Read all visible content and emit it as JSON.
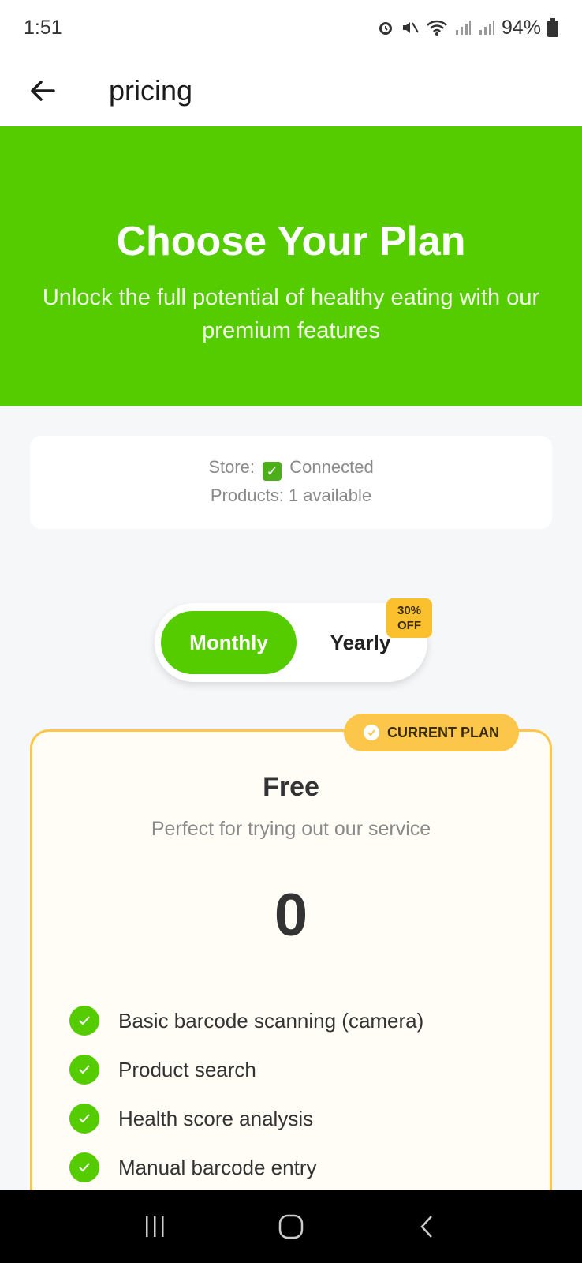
{
  "status_bar": {
    "time": "1:51",
    "battery": "94%",
    "icons": [
      "alarm-icon",
      "mute-icon",
      "wifi-icon",
      "signal-icon",
      "signal-icon",
      "battery-icon"
    ]
  },
  "app_bar": {
    "title": "pricing",
    "back_icon": "arrow-left-icon"
  },
  "hero": {
    "title": "Choose Your Plan",
    "subtitle": "Unlock the full potential of healthy eating with our premium features",
    "background": "#55cc00"
  },
  "store_info": {
    "store_label": "Store:",
    "store_status": "Connected",
    "products": "Products: 1 available"
  },
  "billing_toggle": {
    "monthly": "Monthly",
    "yearly": "Yearly",
    "discount": "30% OFF",
    "selected": "Monthly"
  },
  "plan": {
    "badge": "CURRENT PLAN",
    "name": "Free",
    "description": "Perfect for trying out our service",
    "price": "0",
    "features": [
      "Basic barcode scanning (camera)",
      "Product search",
      "Health score analysis",
      "Manual barcode entry"
    ]
  },
  "nav_bar": {
    "icons": [
      "recents-icon",
      "home-icon",
      "back-icon"
    ]
  },
  "colors": {
    "accent": "#55cc00",
    "badge": "#fbc64a",
    "background": "#f6f7f9"
  }
}
